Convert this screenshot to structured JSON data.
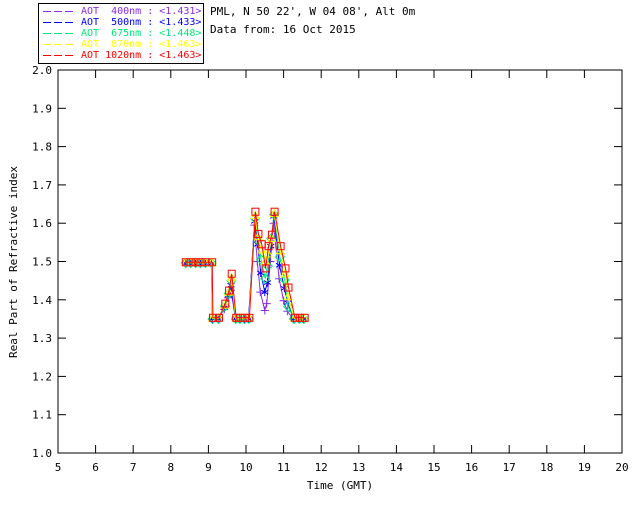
{
  "header": {
    "line1": "PML, N 50 22', W 04 08', Alt 0m",
    "line2": "Data from: 16 Oct 2015"
  },
  "chart_data": {
    "type": "line",
    "title": "",
    "xlabel": "Time (GMT)",
    "ylabel": "Real Part of Refractive index",
    "xlim": [
      5,
      20
    ],
    "ylim": [
      1.0,
      2.0
    ],
    "xtick_labels": [
      "5",
      "6",
      "7",
      "8",
      "9",
      "10",
      "11",
      "12",
      "13",
      "14",
      "15",
      "16",
      "17",
      "18",
      "19",
      "20"
    ],
    "ytick_labels": [
      "1.0",
      "1.1",
      "1.2",
      "1.3",
      "1.4",
      "1.5",
      "1.6",
      "1.7",
      "1.8",
      "1.9",
      "2.0"
    ],
    "grid": false,
    "legend_position": "top-left",
    "frame_color": "#000000",
    "series": [
      {
        "name": "AOT 400nm",
        "wavelength": "400nm",
        "mean_value": "<1.431>",
        "legend_text": "AOT  400nm : <1.431>",
        "color": "#8A2BE2",
        "marker": "plus",
        "points": [
          [
            8.4,
            1.494
          ],
          [
            8.53,
            1.494
          ],
          [
            8.66,
            1.494
          ],
          [
            8.79,
            1.494
          ],
          [
            8.92,
            1.494
          ],
          [
            9.08,
            1.494
          ],
          [
            9.1,
            1.35
          ],
          [
            9.25,
            1.35
          ],
          [
            9.42,
            1.375
          ],
          [
            9.52,
            1.405
          ],
          [
            9.6,
            1.425
          ],
          [
            9.72,
            1.35
          ],
          [
            9.83,
            1.35
          ],
          [
            9.95,
            1.35
          ],
          [
            10.07,
            1.35
          ],
          [
            10.22,
            1.595
          ],
          [
            10.3,
            1.5
          ],
          [
            10.38,
            1.42
          ],
          [
            10.5,
            1.372
          ],
          [
            10.55,
            1.39
          ],
          [
            10.65,
            1.5
          ],
          [
            10.73,
            1.6
          ],
          [
            10.88,
            1.455
          ],
          [
            11.0,
            1.398
          ],
          [
            11.1,
            1.37
          ],
          [
            11.25,
            1.35
          ],
          [
            11.4,
            1.35
          ],
          [
            11.52,
            1.35
          ]
        ]
      },
      {
        "name": "AOT 500nm",
        "wavelength": "500nm",
        "mean_value": "<1.433>",
        "legend_text": "AOT  500nm : <1.433>",
        "color": "#0000FF",
        "marker": "asterisk",
        "points": [
          [
            8.4,
            1.495
          ],
          [
            8.53,
            1.495
          ],
          [
            8.66,
            1.495
          ],
          [
            8.79,
            1.495
          ],
          [
            8.92,
            1.495
          ],
          [
            9.08,
            1.495
          ],
          [
            9.11,
            1.35
          ],
          [
            9.26,
            1.35
          ],
          [
            9.43,
            1.38
          ],
          [
            9.53,
            1.412
          ],
          [
            9.6,
            1.438
          ],
          [
            9.72,
            1.35
          ],
          [
            9.84,
            1.35
          ],
          [
            9.96,
            1.35
          ],
          [
            10.07,
            1.35
          ],
          [
            10.23,
            1.605
          ],
          [
            10.31,
            1.545
          ],
          [
            10.39,
            1.47
          ],
          [
            10.5,
            1.42
          ],
          [
            10.57,
            1.445
          ],
          [
            10.66,
            1.54
          ],
          [
            10.74,
            1.618
          ],
          [
            10.89,
            1.49
          ],
          [
            11.02,
            1.43
          ],
          [
            11.11,
            1.392
          ],
          [
            11.27,
            1.35
          ],
          [
            11.41,
            1.35
          ],
          [
            11.53,
            1.35
          ]
        ]
      },
      {
        "name": "AOT 675nm",
        "wavelength": "675nm",
        "mean_value": "<1.448>",
        "legend_text": "AOT  675nm : <1.448>",
        "color": "#00E878",
        "marker": "diamond",
        "points": [
          [
            8.4,
            1.496
          ],
          [
            8.53,
            1.496
          ],
          [
            8.66,
            1.496
          ],
          [
            8.79,
            1.496
          ],
          [
            8.92,
            1.496
          ],
          [
            9.08,
            1.496
          ],
          [
            9.11,
            1.35
          ],
          [
            9.27,
            1.35
          ],
          [
            9.44,
            1.383
          ],
          [
            9.54,
            1.416
          ],
          [
            9.61,
            1.45
          ],
          [
            9.73,
            1.35
          ],
          [
            9.84,
            1.35
          ],
          [
            9.96,
            1.35
          ],
          [
            10.08,
            1.35
          ],
          [
            10.24,
            1.612
          ],
          [
            10.32,
            1.555
          ],
          [
            10.4,
            1.505
          ],
          [
            10.51,
            1.455
          ],
          [
            10.58,
            1.488
          ],
          [
            10.67,
            1.56
          ],
          [
            10.75,
            1.622
          ],
          [
            10.9,
            1.512
          ],
          [
            11.03,
            1.452
          ],
          [
            11.12,
            1.382
          ],
          [
            11.28,
            1.35
          ],
          [
            11.42,
            1.35
          ],
          [
            11.54,
            1.35
          ]
        ]
      },
      {
        "name": "AOT 870nm",
        "wavelength": "870nm",
        "mean_value": "<1.463>",
        "legend_text": "AOT  870nm : <1.463>",
        "color": "#FFFF00",
        "marker": "triangle",
        "points": [
          [
            8.4,
            1.497
          ],
          [
            8.53,
            1.497
          ],
          [
            8.66,
            1.497
          ],
          [
            8.79,
            1.497
          ],
          [
            8.92,
            1.497
          ],
          [
            9.09,
            1.497
          ],
          [
            9.11,
            1.352
          ],
          [
            9.27,
            1.352
          ],
          [
            9.44,
            1.386
          ],
          [
            9.54,
            1.42
          ],
          [
            9.61,
            1.458
          ],
          [
            9.73,
            1.352
          ],
          [
            9.85,
            1.352
          ],
          [
            9.97,
            1.352
          ],
          [
            10.08,
            1.352
          ],
          [
            10.24,
            1.62
          ],
          [
            10.32,
            1.565
          ],
          [
            10.41,
            1.53
          ],
          [
            10.51,
            1.5
          ],
          [
            10.59,
            1.52
          ],
          [
            10.68,
            1.56
          ],
          [
            10.75,
            1.625
          ],
          [
            10.91,
            1.528
          ],
          [
            11.04,
            1.468
          ],
          [
            11.12,
            1.408
          ],
          [
            11.29,
            1.352
          ],
          [
            11.42,
            1.352
          ],
          [
            11.55,
            1.352
          ]
        ]
      },
      {
        "name": "AOT 1020nm",
        "wavelength": "1020nm",
        "mean_value": "<1.463>",
        "legend_text": "AOT 1020nm : <1.463>",
        "color": "#FF0000",
        "marker": "square",
        "points": [
          [
            8.4,
            1.498
          ],
          [
            8.53,
            1.498
          ],
          [
            8.66,
            1.498
          ],
          [
            8.79,
            1.498
          ],
          [
            8.92,
            1.498
          ],
          [
            9.1,
            1.498
          ],
          [
            9.12,
            1.353
          ],
          [
            9.28,
            1.353
          ],
          [
            9.45,
            1.39
          ],
          [
            9.55,
            1.424
          ],
          [
            9.62,
            1.468
          ],
          [
            9.74,
            1.353
          ],
          [
            9.85,
            1.353
          ],
          [
            9.97,
            1.353
          ],
          [
            10.09,
            1.353
          ],
          [
            10.25,
            1.63
          ],
          [
            10.33,
            1.572
          ],
          [
            10.42,
            1.545
          ],
          [
            10.52,
            1.482
          ],
          [
            10.6,
            1.54
          ],
          [
            10.69,
            1.57
          ],
          [
            10.76,
            1.63
          ],
          [
            10.92,
            1.54
          ],
          [
            11.05,
            1.482
          ],
          [
            11.13,
            1.432
          ],
          [
            11.3,
            1.353
          ],
          [
            11.43,
            1.353
          ],
          [
            11.56,
            1.353
          ]
        ]
      }
    ]
  }
}
